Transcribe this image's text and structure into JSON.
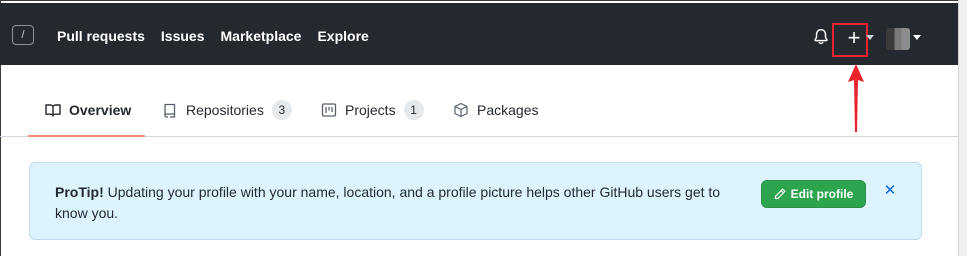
{
  "header": {
    "search_key": "/",
    "nav": [
      "Pull requests",
      "Issues",
      "Marketplace",
      "Explore"
    ]
  },
  "tabs": [
    {
      "label": "Overview",
      "icon": "book-icon",
      "counter": null
    },
    {
      "label": "Repositories",
      "icon": "repo-icon",
      "counter": "3"
    },
    {
      "label": "Projects",
      "icon": "project-icon",
      "counter": "1"
    },
    {
      "label": "Packages",
      "icon": "package-icon",
      "counter": null
    }
  ],
  "flash": {
    "strong": "ProTip!",
    "message": " Updating your profile with your name, location, and a profile picture helps other GitHub users get to know you.",
    "button_label": "Edit profile",
    "close_label": "✕"
  },
  "colors": {
    "header_bg": "#24292f",
    "highlight": "#e8232e",
    "button_green": "#2da44e",
    "flash_bg": "#ddf4ff",
    "tab_underline": "#fd8c73"
  }
}
